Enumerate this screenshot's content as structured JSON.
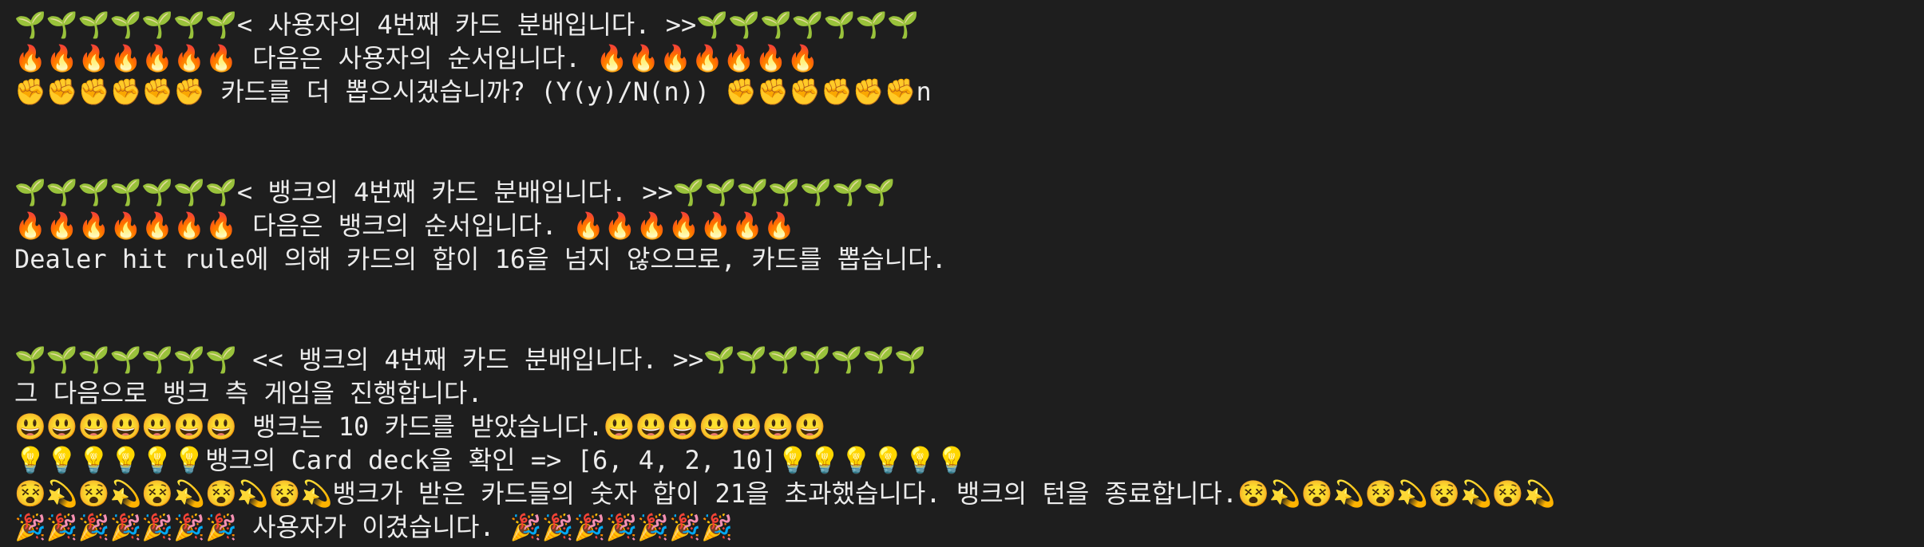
{
  "terminal": {
    "lines": [
      "🌱🌱🌱🌱🌱🌱🌱< 사용자의 4번째 카드 분배입니다. >>🌱🌱🌱🌱🌱🌱🌱",
      "🔥🔥🔥🔥🔥🔥🔥 다음은 사용자의 순서입니다. 🔥🔥🔥🔥🔥🔥🔥",
      "✊✊✊✊✊✊ 카드를 더 뽑으시겠습니까? (Y(y)/N(n)) ✊✊✊✊✊✊n",
      "",
      "",
      "🌱🌱🌱🌱🌱🌱🌱< 뱅크의 4번째 카드 분배입니다. >>🌱🌱🌱🌱🌱🌱🌱",
      "🔥🔥🔥🔥🔥🔥🔥 다음은 뱅크의 순서입니다. 🔥🔥🔥🔥🔥🔥🔥",
      "Dealer hit rule에 의해 카드의 합이 16을 넘지 않으므로, 카드를 뽑습니다.",
      "",
      "",
      "🌱🌱🌱🌱🌱🌱🌱 << 뱅크의 4번째 카드 분배입니다. >>🌱🌱🌱🌱🌱🌱🌱",
      "그 다음으로 뱅크 측 게임을 진행합니다.",
      "😃😃😃😃😃😃😃 뱅크는 10 카드를 받았습니다.😃😃😃😃😃😃😃",
      "💡💡💡💡💡💡뱅크의 Card deck을 확인 => [6, 4, 2, 10]💡💡💡💡💡💡",
      "😵💫😵💫😵💫😵💫😵💫뱅크가 받은 카드들의 숫자 합이 21을 초과했습니다. 뱅크의 턴을 종료합니다.😵💫😵💫😵💫😵💫😵💫",
      "🎉🎉🎉🎉🎉🎉🎉 사용자가 이겼습니다. 🎉🎉🎉🎉🎉🎉🎉"
    ]
  }
}
